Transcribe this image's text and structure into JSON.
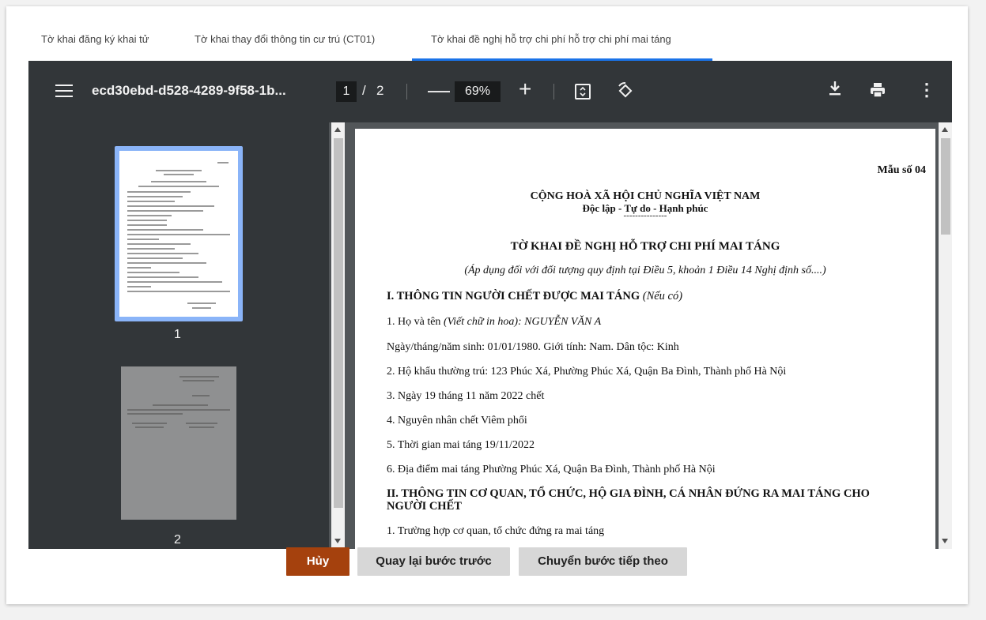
{
  "tabs": [
    {
      "label": "Tờ khai đăng ký khai tử"
    },
    {
      "label": "Tờ khai thay đổi thông tin cư trú (CT01)"
    },
    {
      "label": "Tờ khai đề nghị hỗ trợ chi phí hỗ trợ chi phí mai táng",
      "active": true
    }
  ],
  "viewer": {
    "filename": "ecd30ebd-d528-4289-9f58-1b...",
    "current_page": "1",
    "page_separator": "/",
    "total_pages": "2",
    "zoom": "69%",
    "icons": {
      "menu": "menu-icon",
      "zoom_out": "minus-icon",
      "zoom_in": "plus-icon",
      "fit": "fit-page-icon",
      "rotate": "rotate-icon",
      "download": "download-icon",
      "print": "print-icon",
      "more": "more-vertical-icon"
    },
    "thumbnails": [
      {
        "label": "1",
        "selected": true
      },
      {
        "label": "2",
        "selected": false
      }
    ]
  },
  "document": {
    "form_no": "Mẫu số 04",
    "country": "CỘNG HOÀ XÃ HỘI CHỦ NGHĨA VIỆT NAM",
    "motto": "Độc lập - Tự do - Hạnh phúc",
    "rule": "---------------",
    "title": "TỜ KHAI ĐỀ NGHỊ HỖ TRỢ CHI PHÍ MAI TÁNG",
    "subtitle": "(Áp dụng đối với đối tượng quy định tại Điều 5, khoản 1 Điều 14 Nghị định số....)",
    "section1_title": "I. THÔNG TIN NGƯỜI CHẾT ĐƯỢC MAI TÁNG",
    "section1_note": "(Nếu có)",
    "line1_label": "1. Họ và tên",
    "line1_hint": "(Viết chữ in hoa): NGUYỄN VĂN A",
    "line2": "Ngày/tháng/năm sinh: 01/01/1980. Giới tính: Nam. Dân tộc: Kinh",
    "line3": "2. Hộ khẩu thường trú:  123 Phúc Xá, Phường Phúc Xá, Quận Ba Đình, Thành phố Hà Nội",
    "line4": "3. Ngày 19 tháng 11 năm 2022 chết",
    "line5": "4. Nguyên nhân chết Viêm phổi",
    "line6": "5. Thời gian mai táng 19/11/2022",
    "line7": "6. Địa điểm mai táng Phường Phúc Xá, Quận Ba Đình, Thành phố Hà Nội",
    "section2_line1": "II. THÔNG TIN CƠ QUAN, TỔ CHỨC, HỘ GIA ĐÌNH, CÁ NHÂN ĐỨNG RA MAI TÁNG CHO",
    "section2_line2": "NGƯỜI CHẾT",
    "line8": "1. Trường hợp cơ quan, tổ chức đứng ra mai táng"
  },
  "buttons": {
    "cancel": "Hủy",
    "back": "Quay lại bước trước",
    "next": "Chuyển bước tiếp theo"
  },
  "colors": {
    "tab_active_underline": "#1a73e8",
    "toolbar": "#323639",
    "viewer_bg": "#525659",
    "thumb_selected": "#8ab4f8",
    "cancel_button": "#a5410d",
    "secondary_button": "#d7d7d7"
  }
}
